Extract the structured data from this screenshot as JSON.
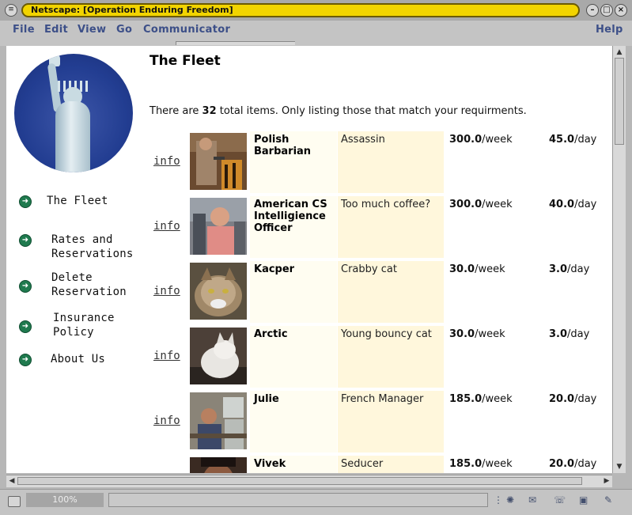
{
  "window": {
    "title": "Netscape: [Operation Enduring Freedom]",
    "minimize_glyph": "–",
    "maximize_glyph": "□",
    "close_glyph": "×"
  },
  "menu": {
    "items": [
      "File",
      "Edit",
      "View",
      "Go",
      "Communicator"
    ],
    "help": "Help"
  },
  "page": {
    "title": "The Fleet",
    "intro_prefix": "There are ",
    "intro_count": "32",
    "intro_suffix": " total items. Only listing those that match your requirments."
  },
  "sidebar": {
    "items": [
      {
        "label_line1": "The Fleet",
        "label_line2": ""
      },
      {
        "label_line1": "Rates and",
        "label_line2": "Reservations"
      },
      {
        "label_line1": "Delete",
        "label_line2": "Reservation"
      },
      {
        "label_line1": "Insurance",
        "label_line2": "Policy"
      },
      {
        "label_line1": "About Us",
        "label_line2": ""
      }
    ]
  },
  "fleet": {
    "info_label": "info",
    "week_suffix": "/week",
    "day_suffix": "/day",
    "rows": [
      {
        "name": "Polish Barbarian",
        "desc": "Assassin",
        "week": "300.0",
        "day": "45.0",
        "img": "warrior"
      },
      {
        "name": "American CS Intelligience Officer",
        "desc": "Too much coffee?",
        "week": "300.0",
        "day": "40.0",
        "img": "man"
      },
      {
        "name": "Kacper",
        "desc": "Crabby cat",
        "week": "30.0",
        "day": "3.0",
        "img": "tabby-cat"
      },
      {
        "name": "Arctic",
        "desc": "Young bouncy cat",
        "week": "30.0",
        "day": "3.0",
        "img": "white-cat"
      },
      {
        "name": "Julie",
        "desc": "French Manager",
        "week": "185.0",
        "day": "20.0",
        "img": "office"
      },
      {
        "name": "Vivek",
        "desc": "Seducer",
        "week": "185.0",
        "day": "20.0",
        "img": "face"
      }
    ]
  },
  "status": {
    "progress": "100%"
  },
  "colors": {
    "title_bar": "#f2d400",
    "menu_text": "#3c4f88",
    "nav_bullet": "#1f7a4e",
    "name_cell": "#fffdf1",
    "desc_cell": "#fff7dc"
  }
}
